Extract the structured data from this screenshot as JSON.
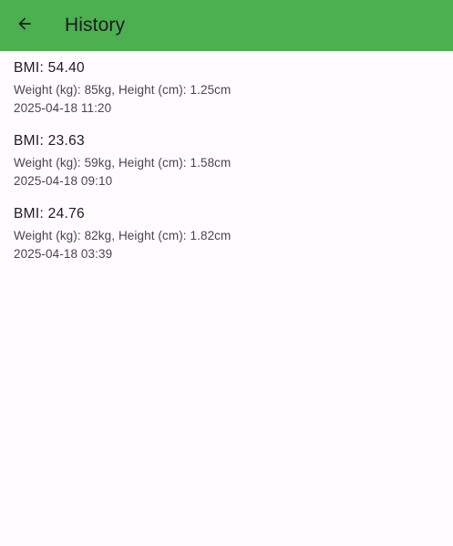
{
  "app_bar": {
    "title": "History",
    "back_icon": "arrow-back-icon",
    "background_color": "#4caf50"
  },
  "history": {
    "items": [
      {
        "bmi": "BMI: 54.40",
        "details": "Weight (kg): 85kg, Height (cm): 1.25cm",
        "date": "2025-04-18 11:20"
      },
      {
        "bmi": "BMI: 23.63",
        "details": "Weight (kg): 59kg, Height (cm): 1.58cm",
        "date": "2025-04-18 09:10"
      },
      {
        "bmi": "BMI: 24.76",
        "details": "Weight (kg): 82kg, Height (cm): 1.82cm",
        "date": "2025-04-18 03:39"
      }
    ]
  }
}
